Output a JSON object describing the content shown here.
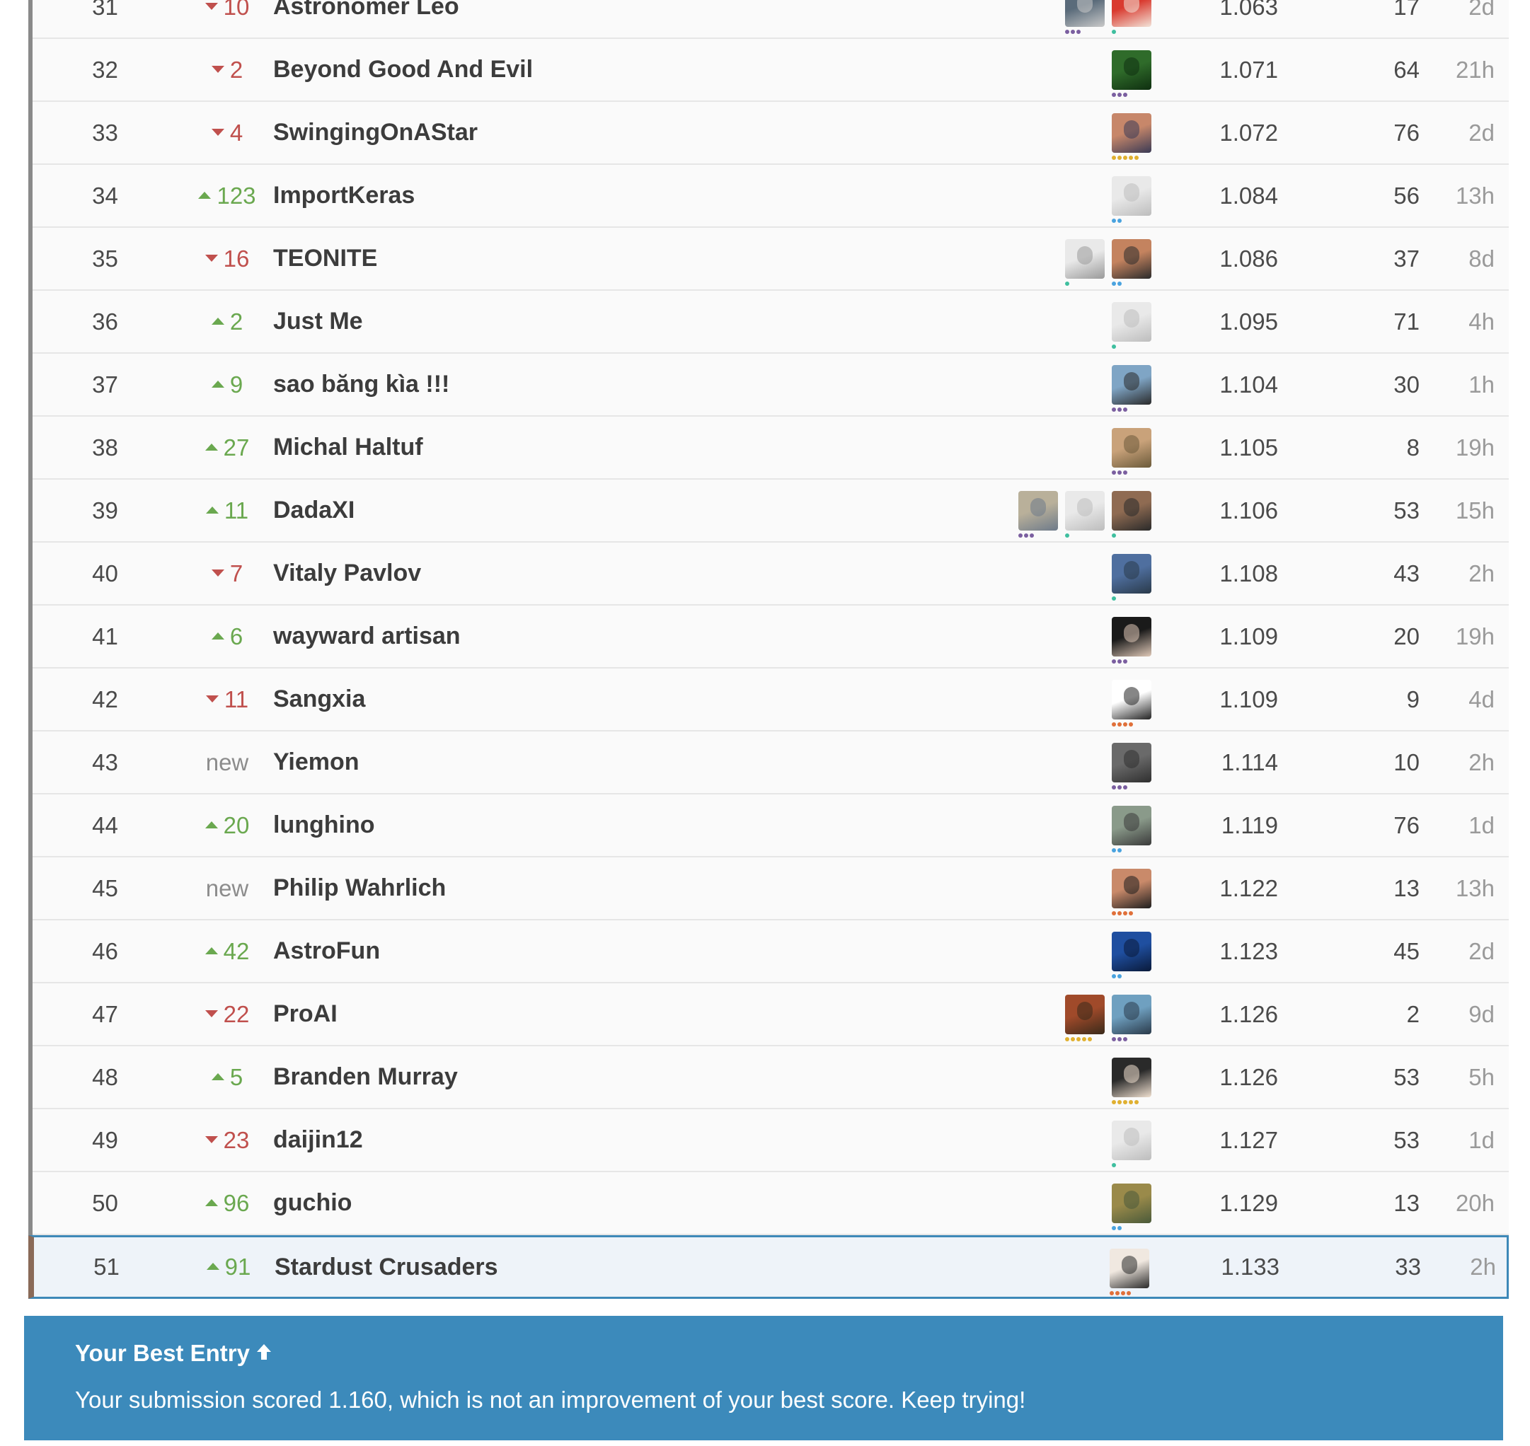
{
  "rows": [
    {
      "rank": "31",
      "delta": "10",
      "dir": "down",
      "team": "Astronomer Leo",
      "score": "1.063",
      "entries": "17",
      "last": "2d",
      "avatars": [
        {
          "c1": "#5a6b7a",
          "c2": "#c9c9c9",
          "dots": "purple",
          "n": 3
        },
        {
          "c1": "#d93a2f",
          "c2": "#f2e3d8",
          "dots": "teal",
          "n": 1
        }
      ]
    },
    {
      "rank": "32",
      "delta": "2",
      "dir": "down",
      "team": "Beyond Good And Evil",
      "score": "1.071",
      "entries": "64",
      "last": "21h",
      "avatars": [
        {
          "c1": "#2f6b2a",
          "c2": "#0f2f10",
          "dots": "purple",
          "n": 3
        }
      ]
    },
    {
      "rank": "33",
      "delta": "4",
      "dir": "down",
      "team": "SwingingOnAStar",
      "score": "1.072",
      "entries": "76",
      "last": "2d",
      "avatars": [
        {
          "c1": "#c7876a",
          "c2": "#3a3a55",
          "dots": "gold",
          "n": 5
        }
      ]
    },
    {
      "rank": "34",
      "delta": "123",
      "dir": "up",
      "team": "ImportKeras",
      "score": "1.084",
      "entries": "56",
      "last": "13h",
      "avatars": [
        {
          "c1": "#e9e9e9",
          "c2": "#bdbdbd",
          "dots": "blue",
          "n": 2
        }
      ]
    },
    {
      "rank": "35",
      "delta": "16",
      "dir": "down",
      "team": "TEONITE",
      "score": "1.086",
      "entries": "37",
      "last": "8d",
      "avatars": [
        {
          "c1": "#e9e9e9",
          "c2": "#9a9a9a",
          "dots": "teal",
          "n": 1
        },
        {
          "c1": "#c4835f",
          "c2": "#2b2b2b",
          "dots": "blue",
          "n": 2
        }
      ]
    },
    {
      "rank": "36",
      "delta": "2",
      "dir": "up",
      "team": "Just Me",
      "score": "1.095",
      "entries": "71",
      "last": "4h",
      "avatars": [
        {
          "c1": "#e9e9e9",
          "c2": "#bdbdbd",
          "dots": "teal",
          "n": 1
        }
      ]
    },
    {
      "rank": "37",
      "delta": "9",
      "dir": "up",
      "team": "sao băng kìa !!!",
      "score": "1.104",
      "entries": "30",
      "last": "1h",
      "avatars": [
        {
          "c1": "#7fa5c5",
          "c2": "#2a2a2a",
          "dots": "purple",
          "n": 3
        }
      ]
    },
    {
      "rank": "38",
      "delta": "27",
      "dir": "up",
      "team": "Michal Haltuf",
      "score": "1.105",
      "entries": "8",
      "last": "19h",
      "avatars": [
        {
          "c1": "#c9a27a",
          "c2": "#6b5a3a",
          "dots": "purple",
          "n": 3
        }
      ]
    },
    {
      "rank": "39",
      "delta": "11",
      "dir": "up",
      "team": "DadaXI",
      "score": "1.106",
      "entries": "53",
      "last": "15h",
      "avatars": [
        {
          "c1": "#b9b09a",
          "c2": "#6d7a8a",
          "dots": "purple",
          "n": 3
        },
        {
          "c1": "#e9e9e9",
          "c2": "#bdbdbd",
          "dots": "teal",
          "n": 1
        },
        {
          "c1": "#8f6b52",
          "c2": "#2a2a2a",
          "dots": "teal",
          "n": 1
        }
      ]
    },
    {
      "rank": "40",
      "delta": "7",
      "dir": "down",
      "team": "Vitaly Pavlov",
      "score": "1.108",
      "entries": "43",
      "last": "2h",
      "avatars": [
        {
          "c1": "#4f6f9f",
          "c2": "#2a3a4a",
          "dots": "teal",
          "n": 1
        }
      ]
    },
    {
      "rank": "41",
      "delta": "6",
      "dir": "up",
      "team": "wayward artisan",
      "score": "1.109",
      "entries": "20",
      "last": "19h",
      "avatars": [
        {
          "c1": "#1a1a1a",
          "c2": "#e0c9b8",
          "dots": "purple",
          "n": 3
        }
      ]
    },
    {
      "rank": "42",
      "delta": "11",
      "dir": "down",
      "team": "Sangxia",
      "score": "1.109",
      "entries": "9",
      "last": "4d",
      "avatars": [
        {
          "c1": "#ffffff",
          "c2": "#222222",
          "dots": "orange",
          "n": 4
        }
      ]
    },
    {
      "rank": "43",
      "delta": "new",
      "dir": "new",
      "team": "Yiemon",
      "score": "1.114",
      "entries": "10",
      "last": "2h",
      "avatars": [
        {
          "c1": "#6a6a6a",
          "c2": "#2f2f2f",
          "dots": "purple",
          "n": 3
        }
      ]
    },
    {
      "rank": "44",
      "delta": "20",
      "dir": "up",
      "team": "lunghino",
      "score": "1.119",
      "entries": "76",
      "last": "1d",
      "avatars": [
        {
          "c1": "#8a9a8a",
          "c2": "#3a3a3a",
          "dots": "blue",
          "n": 2
        }
      ]
    },
    {
      "rank": "45",
      "delta": "new",
      "dir": "new",
      "team": "Philip Wahrlich",
      "score": "1.122",
      "entries": "13",
      "last": "13h",
      "avatars": [
        {
          "c1": "#c98a6a",
          "c2": "#1e1e1e",
          "dots": "orange",
          "n": 4
        }
      ]
    },
    {
      "rank": "46",
      "delta": "42",
      "dir": "up",
      "team": "AstroFun",
      "score": "1.123",
      "entries": "45",
      "last": "2d",
      "avatars": [
        {
          "c1": "#1f4fa0",
          "c2": "#0a1a3a",
          "dots": "blue",
          "n": 2
        }
      ]
    },
    {
      "rank": "47",
      "delta": "22",
      "dir": "down",
      "team": "ProAI",
      "score": "1.126",
      "entries": "2",
      "last": "9d",
      "avatars": [
        {
          "c1": "#a04a2a",
          "c2": "#3a2a1a",
          "dots": "gold",
          "n": 5
        },
        {
          "c1": "#6fa0c0",
          "c2": "#2a3a4a",
          "dots": "purple",
          "n": 3
        }
      ]
    },
    {
      "rank": "48",
      "delta": "5",
      "dir": "up",
      "team": "Branden Murray",
      "score": "1.126",
      "entries": "53",
      "last": "5h",
      "avatars": [
        {
          "c1": "#2a2a2a",
          "c2": "#f0e0d0",
          "dots": "gold",
          "n": 5
        }
      ]
    },
    {
      "rank": "49",
      "delta": "23",
      "dir": "down",
      "team": "daijin12",
      "score": "1.127",
      "entries": "53",
      "last": "1d",
      "avatars": [
        {
          "c1": "#e9e9e9",
          "c2": "#bdbdbd",
          "dots": "teal",
          "n": 1
        }
      ]
    },
    {
      "rank": "50",
      "delta": "96",
      "dir": "up",
      "team": "guchio",
      "score": "1.129",
      "entries": "13",
      "last": "20h",
      "avatars": [
        {
          "c1": "#9a8a4a",
          "c2": "#4a5a3a",
          "dots": "blue",
          "n": 2
        }
      ]
    }
  ],
  "my_row": {
    "rank": "51",
    "delta": "91",
    "dir": "up",
    "team": "Stardust Crusaders",
    "score": "1.133",
    "entries": "33",
    "last": "2h",
    "avatars": [
      {
        "c1": "#f0e8e0",
        "c2": "#2a2a2a",
        "dots": "orange",
        "n": 4
      }
    ]
  },
  "banner": {
    "title": "Your Best Entry",
    "title_icon": "arrow-up-icon",
    "message": "Your submission scored 1.160, which is not an improvement of your best score. Keep trying!"
  },
  "colors": {
    "up": "#6aa84f",
    "down": "#c0504d",
    "banner": "#3c8abb",
    "highlight_border": "#3d88b8",
    "dots": {
      "purple": "#7b5fa0",
      "teal": "#3fbf9f",
      "blue": "#4aa3df",
      "gold": "#e0b030",
      "orange": "#e0703a"
    }
  }
}
